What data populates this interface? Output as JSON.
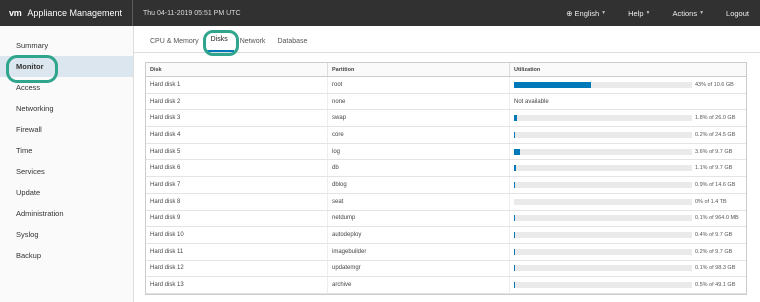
{
  "header": {
    "logo": "vm",
    "title": "Appliance Management",
    "datetime": "Thu 04-11-2019 05:51 PM UTC",
    "language": "English",
    "help": "Help",
    "actions": "Actions",
    "logout": "Logout"
  },
  "sidebar": {
    "items": [
      {
        "label": "Summary",
        "active": false
      },
      {
        "label": "Monitor",
        "active": true
      },
      {
        "label": "Access",
        "active": false
      },
      {
        "label": "Networking",
        "active": false
      },
      {
        "label": "Firewall",
        "active": false
      },
      {
        "label": "Time",
        "active": false
      },
      {
        "label": "Services",
        "active": false
      },
      {
        "label": "Update",
        "active": false
      },
      {
        "label": "Administration",
        "active": false
      },
      {
        "label": "Syslog",
        "active": false
      },
      {
        "label": "Backup",
        "active": false
      }
    ]
  },
  "tabs": [
    {
      "label": "CPU & Memory",
      "active": false
    },
    {
      "label": "Disks",
      "active": true
    },
    {
      "label": "Network",
      "active": false
    },
    {
      "label": "Database",
      "active": false
    }
  ],
  "table": {
    "headers": [
      "Disk",
      "Partition",
      "Utilization"
    ],
    "rows": [
      {
        "disk": "Hard disk 1",
        "partition": "root",
        "pct": 43,
        "text": "43% of 10.6 GB"
      },
      {
        "disk": "Hard disk 2",
        "partition": "none",
        "pct": null,
        "text": "Not available"
      },
      {
        "disk": "Hard disk 3",
        "partition": "swap",
        "pct": 1.8,
        "text": "1.8% of 26.0 GB"
      },
      {
        "disk": "Hard disk 4",
        "partition": "core",
        "pct": 0.2,
        "text": "0.2% of 24.5 GB"
      },
      {
        "disk": "Hard disk 5",
        "partition": "log",
        "pct": 3.6,
        "text": "3.6% of 9.7 GB"
      },
      {
        "disk": "Hard disk 6",
        "partition": "db",
        "pct": 1.1,
        "text": "1.1% of 9.7 GB"
      },
      {
        "disk": "Hard disk 7",
        "partition": "dblog",
        "pct": 0.9,
        "text": "0.9% of 14.6 GB"
      },
      {
        "disk": "Hard disk 8",
        "partition": "seat",
        "pct": 0,
        "text": "0% of 1.4 TB"
      },
      {
        "disk": "Hard disk 9",
        "partition": "netdump",
        "pct": 0.1,
        "text": "0.1% of 964.0 MB"
      },
      {
        "disk": "Hard disk 10",
        "partition": "autodeploy",
        "pct": 0.4,
        "text": "0.4% of 9.7 GB"
      },
      {
        "disk": "Hard disk 11",
        "partition": "imagebuilder",
        "pct": 0.2,
        "text": "0.2% of 9.7 GB"
      },
      {
        "disk": "Hard disk 12",
        "partition": "updatemgr",
        "pct": 0.1,
        "text": "0.1% of 98.3 GB"
      },
      {
        "disk": "Hard disk 13",
        "partition": "archive",
        "pct": 0.5,
        "text": "0.5% of 49.1 GB"
      }
    ]
  },
  "colors": {
    "accent": "#0079b8",
    "highlight": "#2fa58d",
    "header_bg": "#313131"
  }
}
